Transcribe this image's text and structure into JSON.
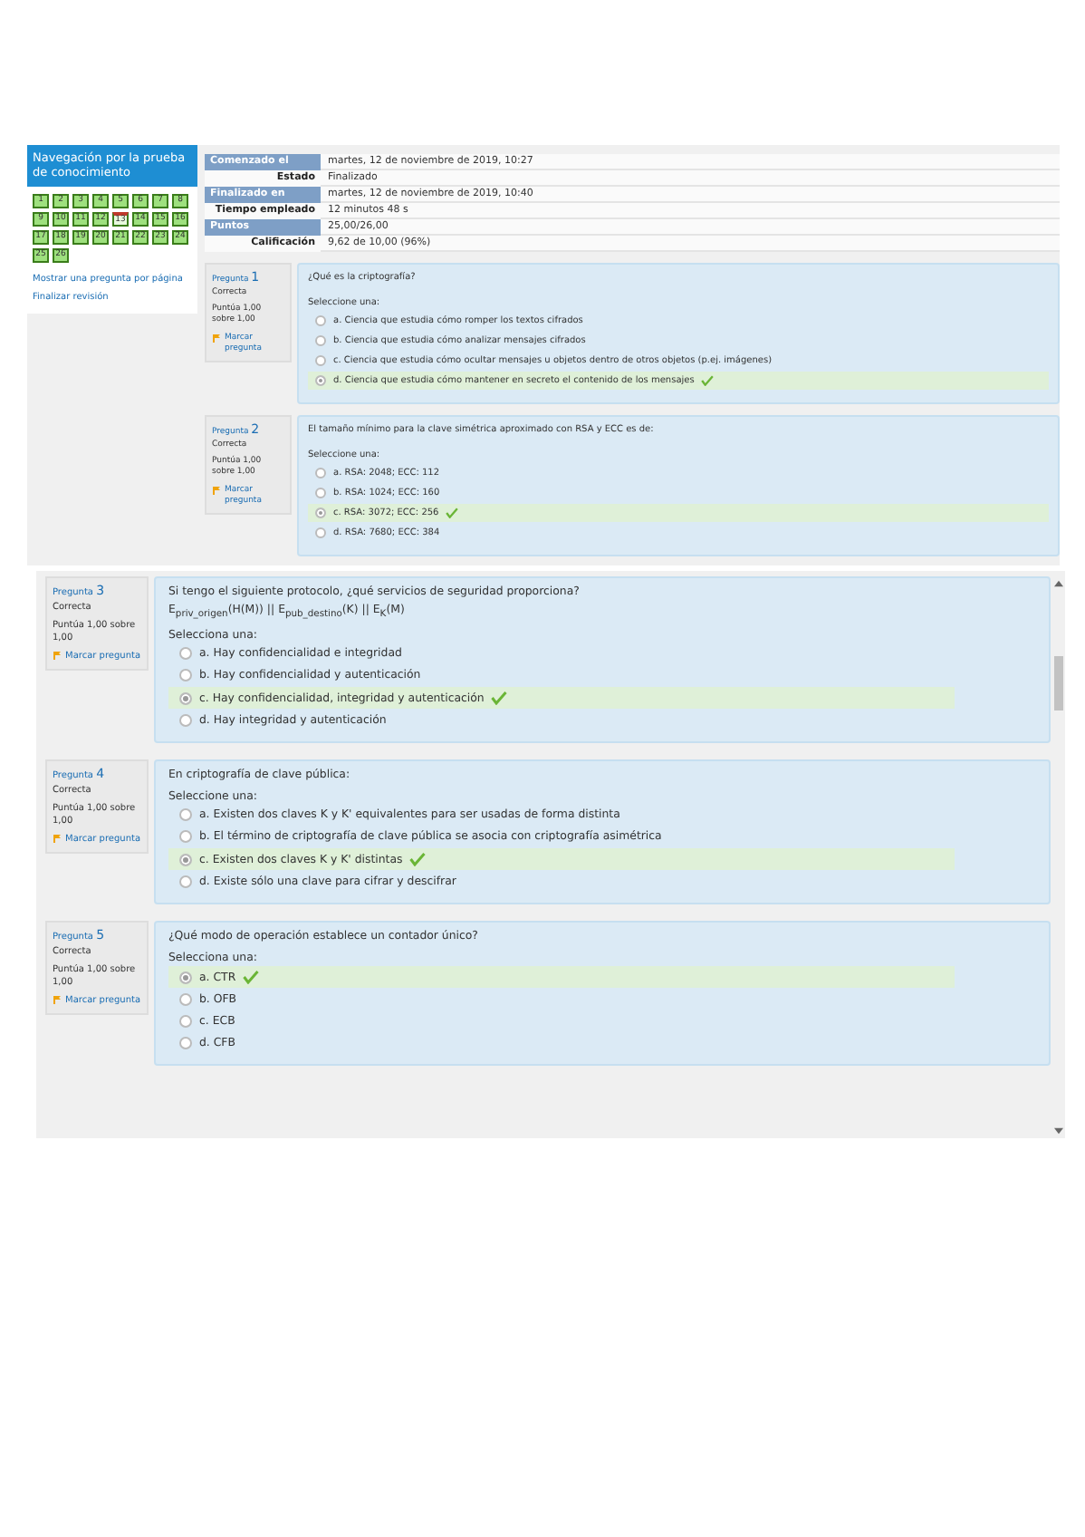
{
  "review_top": {
    "nav": {
      "title": "Navegación por la prueba de conocimiento",
      "buttons": [
        {
          "label": "1",
          "current": false
        },
        {
          "label": "2",
          "current": false
        },
        {
          "label": "3",
          "current": false
        },
        {
          "label": "4",
          "current": false
        },
        {
          "label": "5",
          "current": false
        },
        {
          "label": "6",
          "current": false
        },
        {
          "label": "7",
          "current": false
        },
        {
          "label": "8",
          "current": false
        },
        {
          "label": "9",
          "current": false
        },
        {
          "label": "10",
          "current": false
        },
        {
          "label": "11",
          "current": false
        },
        {
          "label": "12",
          "current": false
        },
        {
          "label": "13",
          "current": true
        },
        {
          "label": "14",
          "current": false
        },
        {
          "label": "15",
          "current": false
        },
        {
          "label": "16",
          "current": false
        },
        {
          "label": "17",
          "current": false
        },
        {
          "label": "18",
          "current": false
        },
        {
          "label": "19",
          "current": false
        },
        {
          "label": "20",
          "current": false
        },
        {
          "label": "21",
          "current": false
        },
        {
          "label": "22",
          "current": false
        },
        {
          "label": "23",
          "current": false
        },
        {
          "label": "24",
          "current": false
        },
        {
          "label": "25",
          "current": false
        },
        {
          "label": "26",
          "current": false
        }
      ],
      "links": [
        "Mostrar una pregunta por página",
        "Finalizar revisión"
      ]
    },
    "summary": [
      {
        "label": "Comenzado el",
        "value": "martes, 12 de noviembre de 2019, 10:27",
        "highlighted": true
      },
      {
        "label": "Estado",
        "value": "Finalizado",
        "highlighted": false
      },
      {
        "label": "Finalizado en",
        "value": "martes, 12 de noviembre de 2019, 10:40",
        "highlighted": true
      },
      {
        "label": "Tiempo empleado",
        "value": "12 minutos 48 s",
        "highlighted": false
      },
      {
        "label": "Puntos",
        "value": "25,00/26,00",
        "highlighted": true
      },
      {
        "label": "Calificación",
        "value": "9,62 de 10,00 (96%)",
        "highlighted": false
      }
    ],
    "questions": [
      {
        "label": "Pregunta",
        "number": "1",
        "status": "Correcta",
        "score": "Puntúa 1,00 sobre 1,00",
        "flag": "Marcar pregunta",
        "text": "¿Qué es la criptografía?",
        "prompt": "Seleccione una:",
        "options": [
          {
            "text": "a. Ciencia que estudia cómo romper los textos cifrados",
            "selected": false,
            "correct": false
          },
          {
            "text": "b. Ciencia que estudia cómo analizar mensajes cifrados",
            "selected": false,
            "correct": false
          },
          {
            "text": "c. Ciencia que estudia cómo ocultar mensajes u objetos dentro de otros objetos (p.ej. imágenes)",
            "selected": false,
            "correct": false
          },
          {
            "text": "d. Ciencia que estudia cómo mantener en secreto el contenido de los mensajes",
            "selected": true,
            "correct": true
          }
        ]
      },
      {
        "label": "Pregunta",
        "number": "2",
        "status": "Correcta",
        "score": "Puntúa 1,00 sobre 1,00",
        "flag": "Marcar pregunta",
        "text": "El tamaño mínimo para la clave simétrica aproximado con RSA y ECC es de:",
        "prompt": "Seleccione una:",
        "options": [
          {
            "text": "a. RSA: 2048; ECC: 112",
            "selected": false,
            "correct": false
          },
          {
            "text": "b. RSA: 1024; ECC: 160",
            "selected": false,
            "correct": false
          },
          {
            "text": "c. RSA: 3072; ECC: 256",
            "selected": true,
            "correct": true
          },
          {
            "text": "d. RSA: 7680; ECC: 384",
            "selected": false,
            "correct": false
          }
        ]
      }
    ]
  },
  "review_bottom": {
    "questions": [
      {
        "label": "Pregunta",
        "number": "3",
        "status": "Correcta",
        "score": "Puntúa 1,00 sobre 1,00",
        "flag": "Marcar pregunta",
        "text": "Si tengo el siguiente protocolo, ¿qué servicios de seguridad proporciona?",
        "formula": "E$_{priv_origen}$(H(M)) || E$_{pub_destino}$(K) || E$_{K}$(M)",
        "prompt": "Selecciona una:",
        "options": [
          {
            "text": "a. Hay confidencialidad e integridad",
            "selected": false,
            "correct": false
          },
          {
            "text": "b. Hay confidencialidad y autenticación",
            "selected": false,
            "correct": false
          },
          {
            "text": "c. Hay confidencialidad, integridad y autenticación",
            "selected": true,
            "correct": true
          },
          {
            "text": "d. Hay integridad y autenticación",
            "selected": false,
            "correct": false
          }
        ]
      },
      {
        "label": "Pregunta",
        "number": "4",
        "status": "Correcta",
        "score": "Puntúa 1,00 sobre 1,00",
        "flag": "Marcar pregunta",
        "text": "En criptografía de clave pública:",
        "prompt": "Seleccione una:",
        "options": [
          {
            "text": "a. Existen dos claves K y K' equivalentes para ser usadas de forma distinta",
            "selected": false,
            "correct": false
          },
          {
            "text": "b. El término de criptografía de clave pública se asocia con criptografía asimétrica",
            "selected": false,
            "correct": false
          },
          {
            "text": "c. Existen dos claves K y K' distintas",
            "selected": true,
            "correct": true
          },
          {
            "text": "d. Existe sólo una clave para cifrar y descifrar",
            "selected": false,
            "correct": false
          }
        ]
      },
      {
        "label": "Pregunta",
        "number": "5",
        "status": "Correcta",
        "score": "Puntúa 1,00 sobre 1,00",
        "flag": "Marcar pregunta",
        "text": "¿Qué modo de operación establece un contador único?",
        "prompt": "Selecciona una:",
        "options": [
          {
            "text": "a. CTR",
            "selected": true,
            "correct": true
          },
          {
            "text": "b. OFB",
            "selected": false,
            "correct": false
          },
          {
            "text": "c. ECB",
            "selected": false,
            "correct": false
          },
          {
            "text": "d. CFB",
            "selected": false,
            "correct": false
          }
        ]
      }
    ]
  }
}
